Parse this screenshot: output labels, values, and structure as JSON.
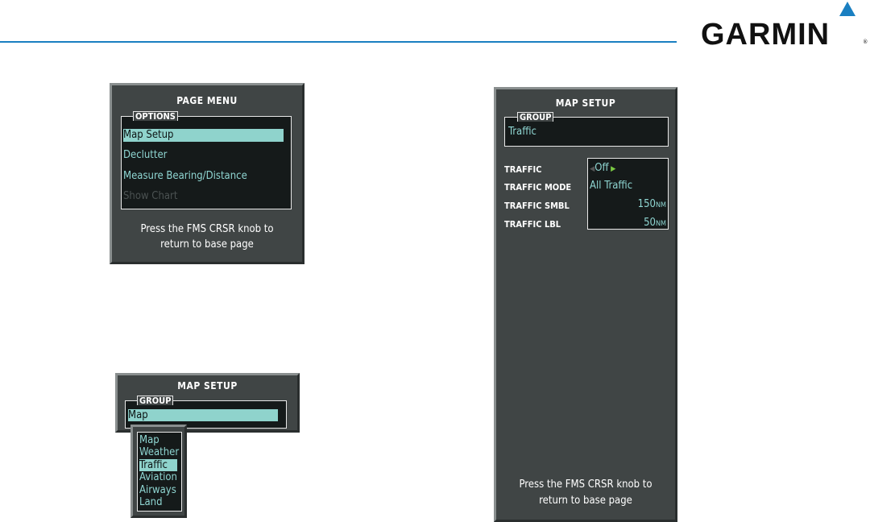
{
  "brand": {
    "logo_text": "GARMIN",
    "registered": "®",
    "accent": "#1a7fc1"
  },
  "page_menu": {
    "title": "PAGE MENU",
    "options_label": "OPTIONS",
    "items": [
      {
        "label": "Map Setup",
        "state": "selected"
      },
      {
        "label": "Declutter",
        "state": "enabled"
      },
      {
        "label": "Measure Bearing/Distance",
        "state": "enabled"
      },
      {
        "label": "Show Chart",
        "state": "disabled"
      }
    ],
    "footer": [
      "Press the FMS CRSR knob to",
      "return to base page"
    ]
  },
  "map_setup_small": {
    "title": "MAP SETUP",
    "group_label": "GROUP",
    "group_value": "Map",
    "dropdown": [
      "Map",
      "Weather",
      "Traffic",
      "Aviation",
      "Airways",
      "Land"
    ],
    "dropdown_selected": "Traffic"
  },
  "map_setup_large": {
    "title": "MAP SETUP",
    "group_label": "GROUP",
    "group_value": "Traffic",
    "rows": [
      {
        "label": "TRAFFIC",
        "value": "Off"
      },
      {
        "label": "TRAFFIC MODE",
        "value": "All Traffic"
      },
      {
        "label": "TRAFFIC SMBL",
        "value": "150",
        "unit": "NM"
      },
      {
        "label": "TRAFFIC LBL",
        "value": "50",
        "unit": "NM"
      }
    ],
    "footer": [
      "Press the FMS CRSR knob to",
      "return to base page"
    ]
  }
}
